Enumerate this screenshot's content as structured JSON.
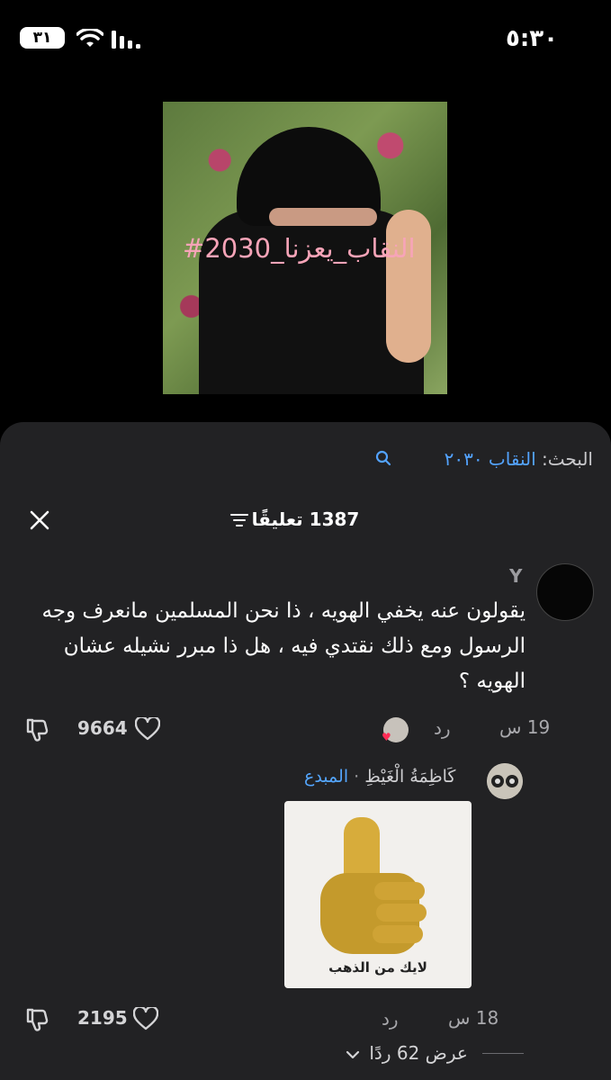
{
  "status_bar": {
    "time": "٥:٣٠",
    "battery": "٣١"
  },
  "video": {
    "hashtag_overlay": "#النقاب_يعزنا_2030"
  },
  "search": {
    "label": "البحث:",
    "query": "النقاب ٢٠٣٠"
  },
  "comments_header": {
    "count_text": "1387 تعليقًا"
  },
  "comments": [
    {
      "username": "Y",
      "text": "يقولون عنه يخفي الهويه ، ذا نحن المسلمين مانعرف وجه الرسول ومع ذلك نقتدي فيه ، هل ذا مبرر نشيله عشان الهويه ؟",
      "time": "19 س",
      "reply_label": "رد",
      "likes": "9664"
    }
  ],
  "reply": {
    "creator_badge": "المبدع",
    "separator": "·",
    "username": "كَاظِمَةُ الْغَيْظِ",
    "sticker_caption": "لايك من الذهب",
    "time": "18 س",
    "reply_label": "رد",
    "likes": "2195"
  },
  "view_replies": {
    "label": "عرض 62 ردًا"
  },
  "colors": {
    "accent": "#53a3ff",
    "sheet_bg": "#222224",
    "heart_badge": "#ff2b55"
  }
}
